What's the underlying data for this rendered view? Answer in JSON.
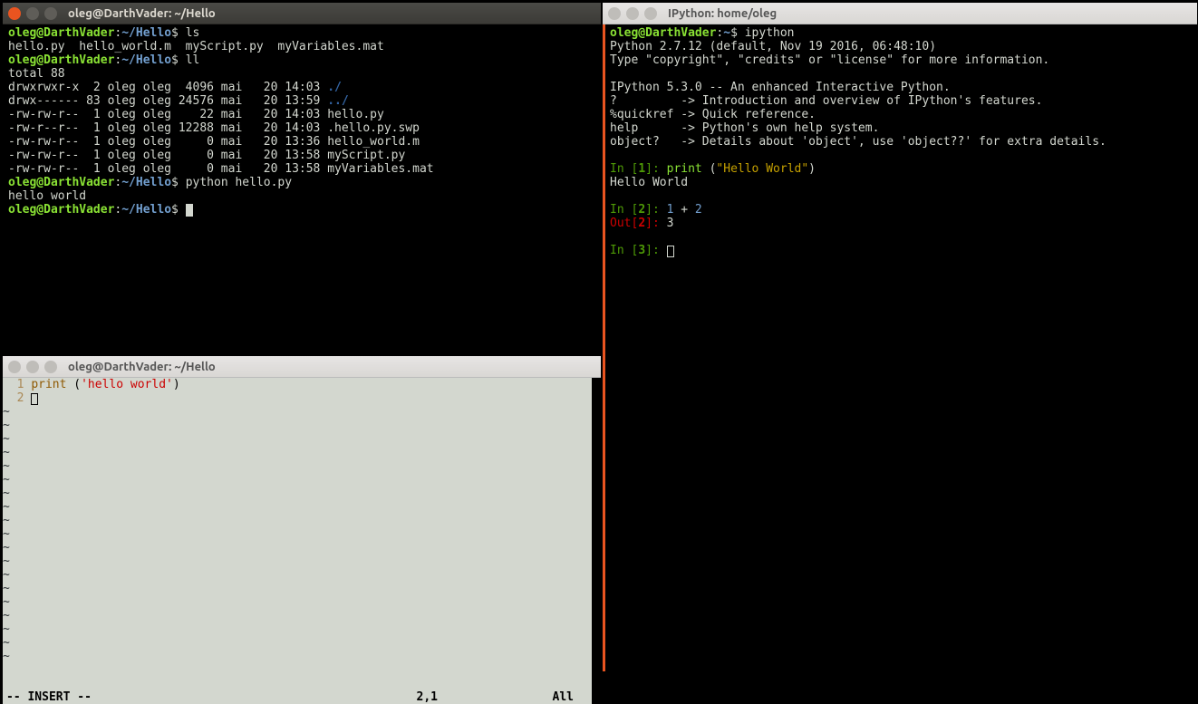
{
  "top_terminal": {
    "title": "oleg@DarthVader: ~/Hello",
    "prompt_user": "oleg@DarthVader",
    "prompt_sep": ":",
    "prompt_path": "~/Hello",
    "prompt_sym": "$",
    "cmd1": "ls",
    "ls_output": "hello.py  hello_world.m  myScript.py  myVariables.mat",
    "cmd2": "ll",
    "ll_total": "total 88",
    "rows": [
      {
        "perm": "drwxrwxr-x",
        "links": "2",
        "owner": "oleg",
        "group": "oleg",
        "size": "4096",
        "month": "mai",
        "day": "20",
        "time": "14:03",
        "name": "./",
        "dir": true
      },
      {
        "perm": "drwx------",
        "links": "83",
        "owner": "oleg",
        "group": "oleg",
        "size": "24576",
        "month": "mai",
        "day": "20",
        "time": "13:59",
        "name": "../",
        "dir": true
      },
      {
        "perm": "-rw-rw-r--",
        "links": "1",
        "owner": "oleg",
        "group": "oleg",
        "size": "22",
        "month": "mai",
        "day": "20",
        "time": "14:03",
        "name": "hello.py",
        "dir": false
      },
      {
        "perm": "-rw-r--r--",
        "links": "1",
        "owner": "oleg",
        "group": "oleg",
        "size": "12288",
        "month": "mai",
        "day": "20",
        "time": "14:03",
        "name": ".hello.py.swp",
        "dir": false
      },
      {
        "perm": "-rw-rw-r--",
        "links": "1",
        "owner": "oleg",
        "group": "oleg",
        "size": "0",
        "month": "mai",
        "day": "20",
        "time": "13:36",
        "name": "hello_world.m",
        "dir": false
      },
      {
        "perm": "-rw-rw-r--",
        "links": "1",
        "owner": "oleg",
        "group": "oleg",
        "size": "0",
        "month": "mai",
        "day": "20",
        "time": "13:58",
        "name": "myScript.py",
        "dir": false
      },
      {
        "perm": "-rw-rw-r--",
        "links": "1",
        "owner": "oleg",
        "group": "oleg",
        "size": "0",
        "month": "mai",
        "day": "20",
        "time": "13:58",
        "name": "myVariables.mat",
        "dir": false
      }
    ],
    "cmd3": "python hello.py",
    "output3": "hello world"
  },
  "ipython": {
    "title": "IPython: home/oleg",
    "prompt_user": "oleg@DarthVader",
    "prompt_path": "~",
    "prompt_sym": "$",
    "cmd": "ipython",
    "banner1": "Python 2.7.12 (default, Nov 19 2016, 06:48:10)",
    "banner2": "Type \"copyright\", \"credits\" or \"license\" for more information.",
    "banner3": "IPython 5.3.0 -- An enhanced Interactive Python.",
    "help1": "?         -> Introduction and overview of IPython's features.",
    "help2": "%quickref -> Quick reference.",
    "help3": "help      -> Python's own help system.",
    "help4": "object?   -> Details about 'object', use 'object??' for extra details.",
    "in1_label": "In [",
    "in1_num": "1",
    "in1_close": "]: ",
    "in1_code_a": "print ",
    "in1_code_b": "(",
    "in1_str": "\"Hello World\"",
    "in1_code_c": ")",
    "out1": "Hello World",
    "in2_num": "2",
    "in2_code": "1 ",
    "in2_plus": "+",
    "in2_code2": " 2",
    "out2_label": "Out[",
    "out2_num": "2",
    "out2_close": "]: ",
    "out2_val": "3",
    "in3_num": "3"
  },
  "vim": {
    "title": "oleg@DarthVader: ~/Hello",
    "line1_num": "  1 ",
    "line1_key": "print ",
    "line1_paren": "(",
    "line1_str": "'hello world'",
    "line1_close": ")",
    "line2_num": "  2 ",
    "status_mode": "-- INSERT --",
    "status_pos": "2,1",
    "status_all": "All"
  }
}
